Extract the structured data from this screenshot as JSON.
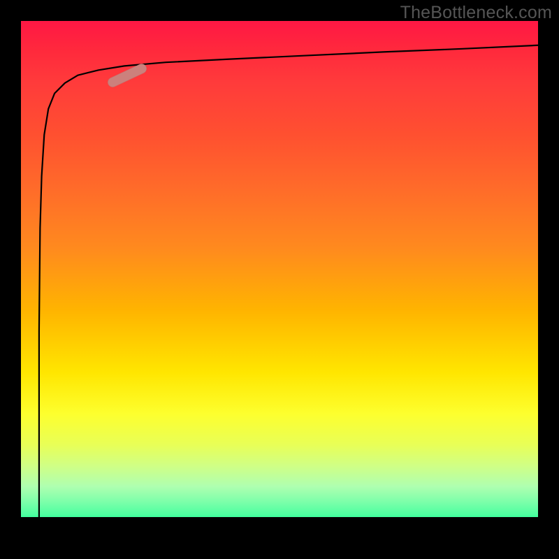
{
  "watermark": "TheBottleneck.com",
  "chart_data": {
    "type": "line",
    "title": "",
    "xlabel": "",
    "ylabel": "",
    "xlim": [
      0,
      100
    ],
    "ylim": [
      0,
      100
    ],
    "grid": false,
    "legend": false,
    "series": [
      {
        "name": "curve",
        "x": [
          3.5,
          3.5,
          3.7,
          4.0,
          4.5,
          5.3,
          6.5,
          8.5,
          11,
          15,
          20,
          28,
          40,
          55,
          70,
          85,
          100
        ],
        "y": [
          2,
          40,
          60,
          70,
          78,
          83,
          86,
          88,
          89.5,
          90.5,
          91.3,
          92,
          92.6,
          93.3,
          94,
          94.6,
          95.3
        ]
      }
    ],
    "annotations": [
      {
        "name": "highlight-pill",
        "x": 20.5,
        "y": 89.5,
        "angle_deg": -25
      }
    ],
    "background_gradient": [
      "#ff1744",
      "#ff6a2a",
      "#ffe600",
      "#fdff2e",
      "#00ff8f"
    ]
  }
}
